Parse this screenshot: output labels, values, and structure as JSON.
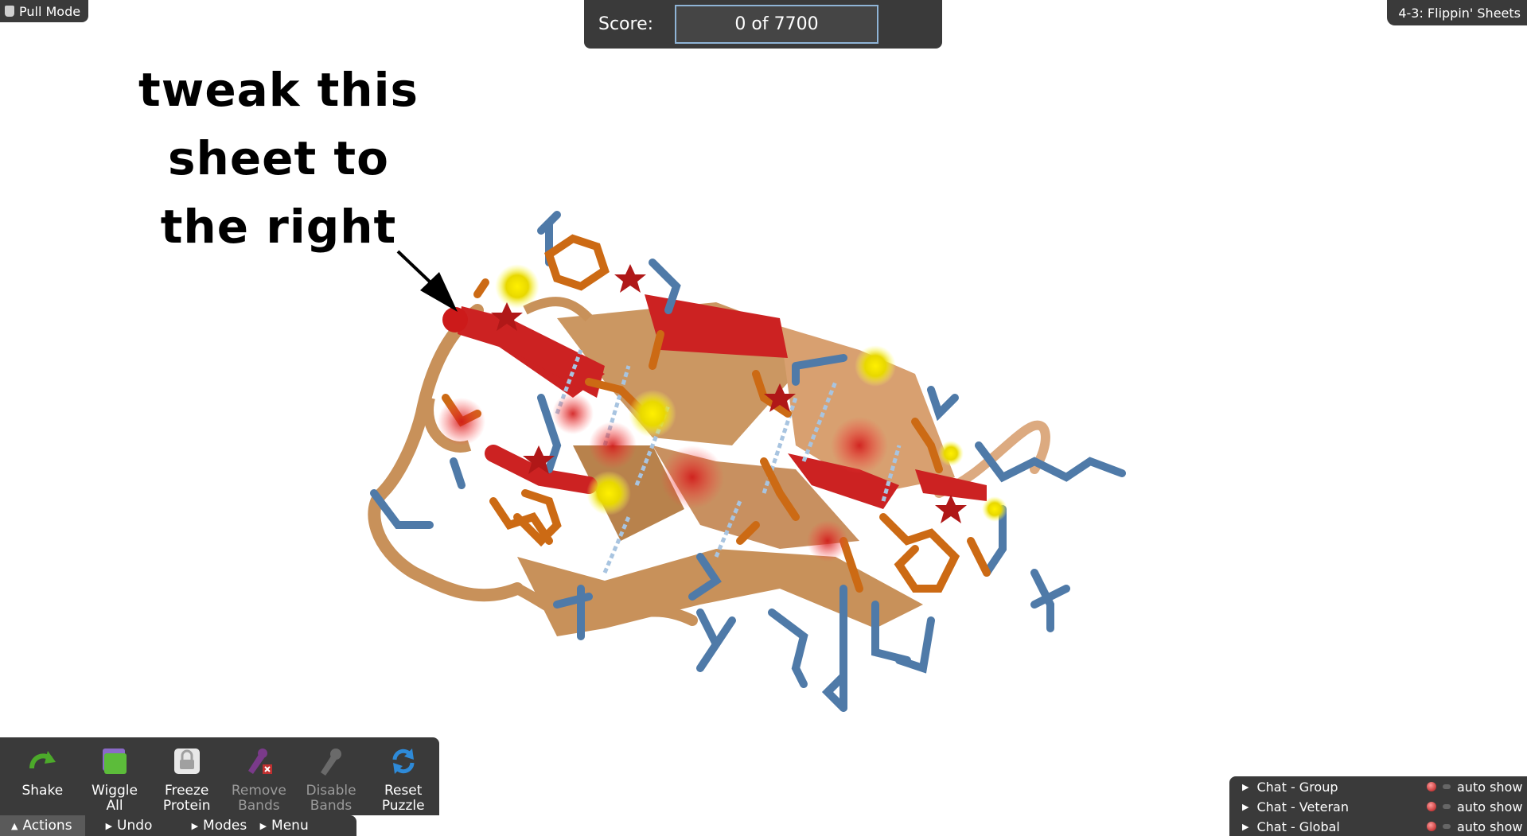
{
  "mode": {
    "label": "Pull Mode",
    "icon": "hand-icon"
  },
  "puzzle": {
    "title": "4-3: Flippin' Sheets"
  },
  "score": {
    "label": "Score:",
    "value": "0 of 7700"
  },
  "annotation": {
    "lines": [
      "tweak this",
      "sheet to",
      "the right"
    ]
  },
  "actions": [
    {
      "label1": "Shake",
      "label2": "",
      "icon": "shake-icon",
      "enabled": true
    },
    {
      "label1": "Wiggle",
      "label2": "All",
      "icon": "wiggle-icon",
      "enabled": true
    },
    {
      "label1": "Freeze",
      "label2": "Protein",
      "icon": "lock-icon",
      "enabled": true
    },
    {
      "label1": "Remove",
      "label2": "Bands",
      "icon": "remove-bands-icon",
      "enabled": false
    },
    {
      "label1": "Disable",
      "label2": "Bands",
      "icon": "disable-bands-icon",
      "enabled": false
    },
    {
      "label1": "Reset",
      "label2": "Puzzle",
      "icon": "reset-icon",
      "enabled": true
    }
  ],
  "tabs": [
    {
      "label": "Actions",
      "active": true,
      "arrow": "▲"
    },
    {
      "label": "Undo",
      "active": false,
      "arrow": "▶"
    },
    {
      "label": "Modes",
      "active": false,
      "arrow": "▶"
    },
    {
      "label": "Menu",
      "active": false,
      "arrow": "▶"
    }
  ],
  "chat": [
    {
      "name": "Chat - Group",
      "auto": "auto show"
    },
    {
      "name": "Chat - Veteran",
      "auto": "auto show"
    },
    {
      "name": "Chat - Global",
      "auto": "auto show"
    }
  ],
  "colors": {
    "panel": "#3a3a3a",
    "sheet_highlight": "#cc2222",
    "ribbon": "#c8915a",
    "sidechain_blue": "#4f7aa8",
    "sidechain_orange": "#cc6a14",
    "clash_yellow": "#f0e000"
  }
}
